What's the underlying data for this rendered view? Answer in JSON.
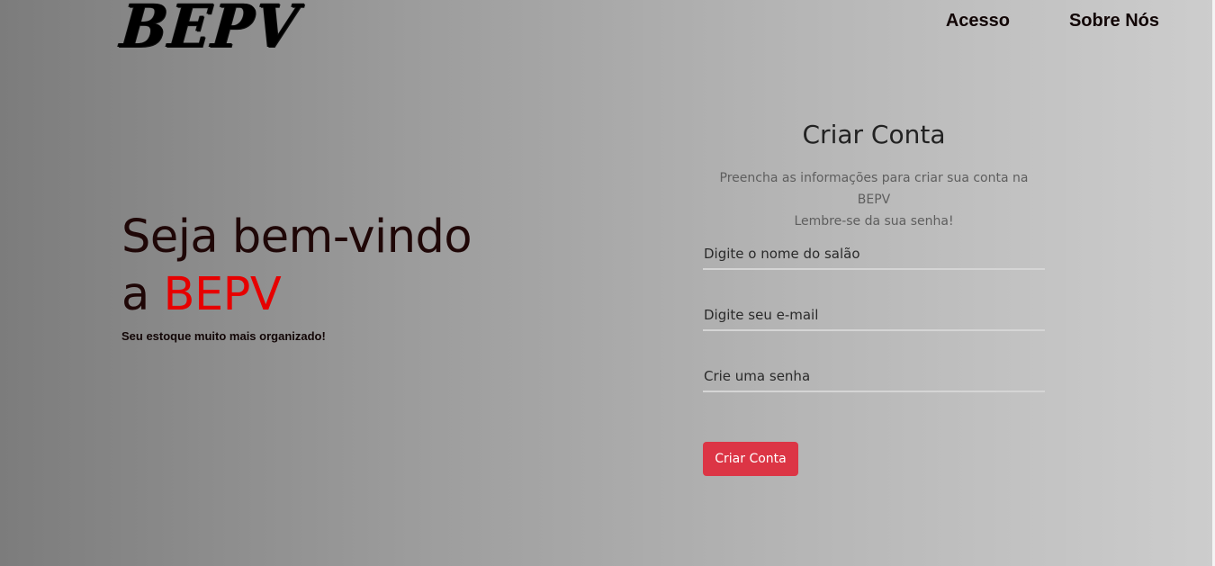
{
  "header": {
    "logo_text": "BEPV",
    "nav": {
      "access_label": "Acesso",
      "about_label": "Sobre Nós"
    }
  },
  "hero": {
    "title_line1": "Seja bem-vindo",
    "title_prefix": "a ",
    "title_brand": "BEPV",
    "subtitle": "Seu estoque muito mais organizado!"
  },
  "form": {
    "title": "Criar Conta",
    "description_line1": "Preencha as informações para criar sua conta na BEPV",
    "description_line2": "Lembre-se da sua senha!",
    "salon_name_placeholder": "Digite o nome do salão",
    "email_placeholder": "Digite seu e-mail",
    "password_placeholder": "Crie uma senha",
    "submit_label": "Criar Conta"
  },
  "colors": {
    "brand_red": "#e60000",
    "button_red": "#dc3545"
  }
}
